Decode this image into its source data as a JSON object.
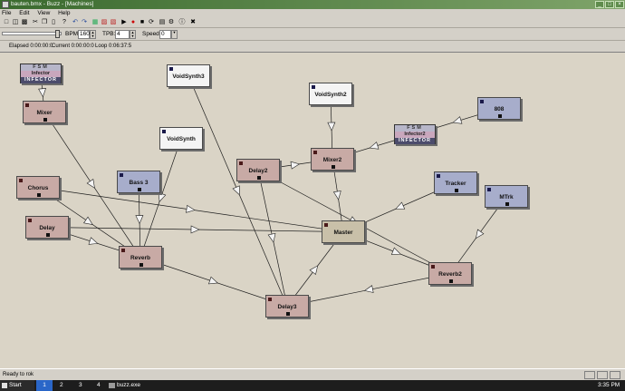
{
  "window": {
    "title": "bauten.bmx - Buzz - [Machines]",
    "controls": [
      "_",
      "□",
      "×"
    ]
  },
  "menu": [
    "File",
    "Edit",
    "View",
    "Help"
  ],
  "tempo": {
    "bpm_label": "BPM:",
    "bpm_value": "160",
    "tpb_label": "TPB:",
    "tpb_value": "4",
    "speed_label": "Speed:",
    "speed_value": "0"
  },
  "info": {
    "elapsed": "Elapsed 0:00:00:0",
    "current": "Current 0:00:00:0",
    "loop": "Loop 0:06:37:5"
  },
  "machines": [
    {
      "id": "infector",
      "kind": "skin",
      "skin_top": "FSM",
      "label": "Infector",
      "skin_bottom": "INFECTOR"
    },
    {
      "id": "mixer",
      "kind": "eff",
      "label": "Mixer"
    },
    {
      "id": "voidsynth3",
      "kind": "white",
      "label": "VoidSynth3"
    },
    {
      "id": "voidsynth2",
      "kind": "white",
      "label": "VoidSynth2"
    },
    {
      "id": "voidsynth",
      "kind": "white",
      "label": "VoidSynth"
    },
    {
      "id": "infector2",
      "kind": "skin",
      "skin_top": "FSM",
      "label": "Infector2",
      "skin_bottom": "INFECTOR"
    },
    {
      "id": "s808",
      "kind": "gen",
      "label": "808"
    },
    {
      "id": "mixer2",
      "kind": "eff",
      "label": "Mixer2"
    },
    {
      "id": "delay2",
      "kind": "eff",
      "label": "Delay2"
    },
    {
      "id": "chorus",
      "kind": "eff",
      "label": "Chorus"
    },
    {
      "id": "bass3",
      "kind": "gen",
      "label": "Bass 3"
    },
    {
      "id": "tracker",
      "kind": "gen",
      "label": "Tracker"
    },
    {
      "id": "mtrk",
      "kind": "gen",
      "label": "MTrk"
    },
    {
      "id": "delay",
      "kind": "eff",
      "label": "Delay"
    },
    {
      "id": "master",
      "kind": "mas",
      "label": "Master"
    },
    {
      "id": "reverb",
      "kind": "eff",
      "label": "Reverb"
    },
    {
      "id": "reverb2",
      "kind": "eff",
      "label": "Reverb2"
    },
    {
      "id": "delay3",
      "kind": "eff",
      "label": "Delay3"
    }
  ],
  "connections": [
    [
      "infector",
      "mixer"
    ],
    [
      "mixer",
      "reverb"
    ],
    [
      "voidsynth3",
      "delay3"
    ],
    [
      "voidsynth2",
      "mixer2"
    ],
    [
      "voidsynth",
      "reverb"
    ],
    [
      "infector2",
      "mixer2"
    ],
    [
      "s808",
      "infector2"
    ],
    [
      "delay2",
      "mixer2"
    ],
    [
      "mixer2",
      "master"
    ],
    [
      "delay2",
      "reverb2"
    ],
    [
      "chorus",
      "master"
    ],
    [
      "chorus",
      "reverb"
    ],
    [
      "bass3",
      "reverb"
    ],
    [
      "delay",
      "reverb"
    ],
    [
      "delay",
      "master"
    ],
    [
      "reverb",
      "delay3"
    ],
    [
      "delay3",
      "master"
    ],
    [
      "reverb2",
      "delay3"
    ],
    [
      "tracker",
      "master"
    ],
    [
      "mtrk",
      "reverb2"
    ],
    [
      "master",
      "reverb2"
    ],
    [
      "delay2",
      "delay3"
    ]
  ],
  "status": "Ready to rok",
  "taskbar": {
    "start": "Start",
    "desktops": [
      "1",
      "2",
      "3",
      "4"
    ],
    "task": "buzz.exe",
    "clock": "3:35 PM"
  }
}
